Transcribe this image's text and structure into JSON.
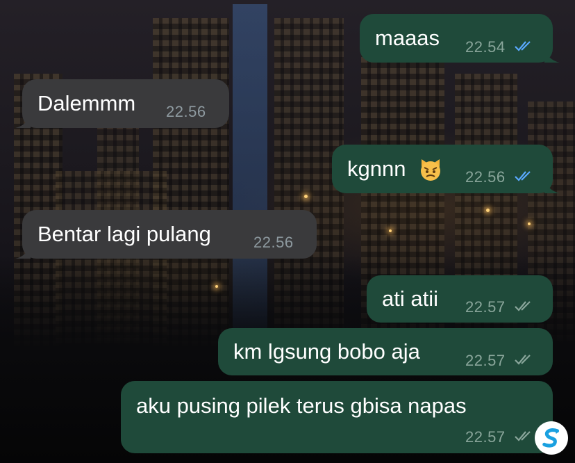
{
  "colors": {
    "outgoing_bubble": "#1f4a3a",
    "incoming_bubble": "#3a3a3c",
    "read_tick": "#5aa9ff",
    "sent_tick": "#8aa69b",
    "timestamp": "#8e9aa0"
  },
  "messages": [
    {
      "direction": "outgoing",
      "text": "maaas",
      "time": "22.54",
      "status": "read"
    },
    {
      "direction": "incoming",
      "text": "Dalemmm",
      "time": "22.56"
    },
    {
      "direction": "outgoing",
      "text": "kgnnn",
      "emoji": "angry-cat-emoji",
      "time": "22.56",
      "status": "read"
    },
    {
      "direction": "incoming",
      "text": "Bentar lagi pulang",
      "time": "22.56"
    },
    {
      "direction": "outgoing",
      "text": "ati atii",
      "time": "22.57",
      "status": "delivered"
    },
    {
      "direction": "outgoing",
      "text": "km lgsung bobo aja",
      "time": "22.57",
      "status": "delivered"
    },
    {
      "direction": "outgoing",
      "text": "aku pusing pilek terus gbisa napas",
      "time": "22.57",
      "status": "delivered"
    }
  ],
  "watermark": {
    "icon": "app-logo-icon"
  }
}
